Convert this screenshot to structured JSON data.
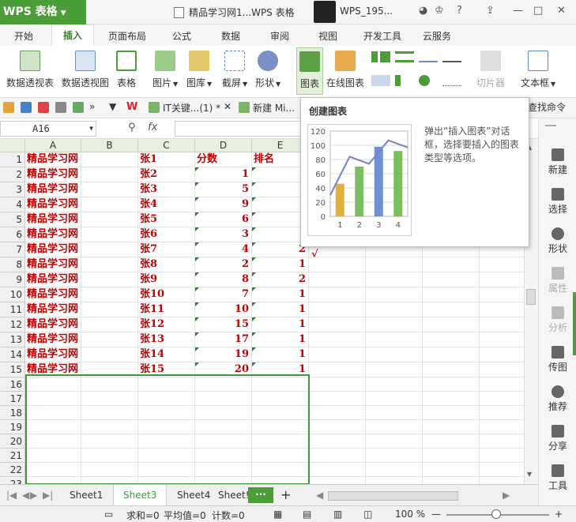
{
  "app": {
    "name": "WPS 表格",
    "doc_title": "精品学习网1...WPS 表格",
    "user": "WPS_195..."
  },
  "menu": [
    "开始",
    "插入",
    "页面布局",
    "公式",
    "数据",
    "审阅",
    "视图",
    "开发工具",
    "云服务"
  ],
  "ribbon": {
    "pivot_table": "数据透视表",
    "pivot_chart": "数据透视图",
    "table": "表格",
    "picture": "图片",
    "gallery": "图库",
    "screenshot": "截屏",
    "shapes": "形状",
    "chart": "图表",
    "online_chart": "在线图表",
    "slicer": "切片器",
    "textbox": "文本框"
  },
  "doc_tabs": [
    "IT关键...(1) *",
    "新建 Mi..."
  ],
  "find_command": "查找命令",
  "name_box": "A16",
  "fx_label": "fx",
  "columns": [
    "A",
    "B",
    "C",
    "D",
    "E"
  ],
  "rows": [
    "1",
    "2",
    "3",
    "4",
    "5",
    "6",
    "7",
    "8",
    "9",
    "10",
    "11",
    "12",
    "13",
    "14",
    "15",
    "16",
    "17",
    "18",
    "19",
    "20",
    "21",
    "22",
    "23"
  ],
  "table": [
    [
      "精品学习网",
      "张1",
      "分数",
      "排名"
    ],
    [
      "精品学习网",
      "张2",
      "1",
      ""
    ],
    [
      "精品学习网",
      "张3",
      "5",
      ""
    ],
    [
      "精品学习网",
      "张4",
      "9",
      ""
    ],
    [
      "精品学习网",
      "张5",
      "6",
      ""
    ],
    [
      "精品学习网",
      "张6",
      "3",
      ""
    ],
    [
      "精品学习网",
      "张7",
      "4",
      "2"
    ],
    [
      "精品学习网",
      "张8",
      "2",
      "1"
    ],
    [
      "精品学习网",
      "张9",
      "8",
      "2"
    ],
    [
      "精品学习网",
      "张10",
      "7",
      "1"
    ],
    [
      "精品学习网",
      "张11",
      "10",
      "1"
    ],
    [
      "精品学习网",
      "张12",
      "15",
      "1"
    ],
    [
      "精品学习网",
      "张13",
      "17",
      "1"
    ],
    [
      "精品学习网",
      "张14",
      "19",
      "1"
    ],
    [
      "精品学习网",
      "张15",
      "20",
      "1"
    ]
  ],
  "check_mark": "√",
  "tooltip": {
    "title": "创建图表",
    "desc": "弹出“插入图表”对话框，选择要插入的图表类型等选项。"
  },
  "chart_data": {
    "type": "bar",
    "categories": [
      "1",
      "2",
      "3",
      "4"
    ],
    "values": [
      46,
      70,
      98,
      92
    ],
    "line_values": [
      30,
      84,
      74,
      107
    ],
    "ylim": [
      0,
      120
    ],
    "yticks": [
      "120",
      "100",
      "80",
      "60",
      "40",
      "20",
      "0"
    ],
    "colors": [
      "#e1b13e",
      "#7bbe5d",
      "#6f8fd4",
      "#7bbe5d"
    ],
    "line_color": "#7a82c4"
  },
  "right_pane": {
    "new": "新建",
    "select": "选择",
    "shape": "形状",
    "property": "属性",
    "analyze": "分析",
    "picture": "传图",
    "recommend": "推荐",
    "share": "分享",
    "tools": "工具"
  },
  "sheets": [
    "Sheet1",
    "Sheet3",
    "Sheet4",
    "Sheet!"
  ],
  "status": {
    "sum": "求和=0",
    "avg": "平均值=0",
    "count": "计数=0",
    "zoom": "100 %"
  }
}
